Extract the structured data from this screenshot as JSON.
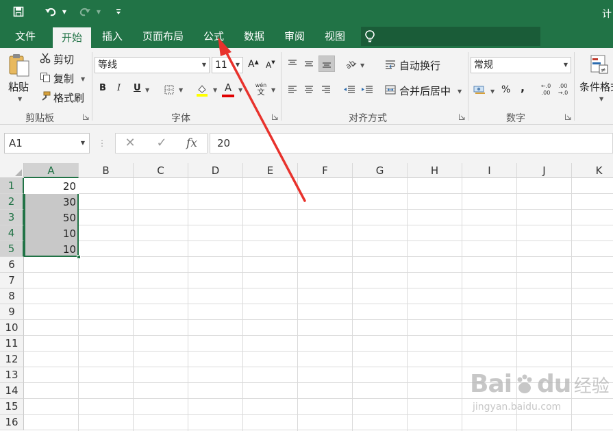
{
  "title_bar": {
    "save_icon": "save-icon",
    "undo_icon": "undo-icon",
    "redo_icon": "redo-icon",
    "customize_icon": "customize-qat-icon",
    "title_text": "计"
  },
  "tabs": [
    {
      "label": "文件",
      "active": false
    },
    {
      "label": "开始",
      "active": true
    },
    {
      "label": "插入",
      "active": false
    },
    {
      "label": "页面布局",
      "active": false
    },
    {
      "label": "公式",
      "active": false
    },
    {
      "label": "数据",
      "active": false
    },
    {
      "label": "审阅",
      "active": false
    },
    {
      "label": "视图",
      "active": false
    }
  ],
  "tell_me_icon": "lightbulb-icon",
  "ribbon": {
    "clipboard": {
      "paste_label": "粘贴",
      "cut_label": "剪切",
      "copy_label": "复制",
      "format_painter_label": "格式刷",
      "group_label": "剪贴板"
    },
    "font": {
      "font_name": "等线",
      "font_size": "11",
      "grow_label": "A",
      "shrink_label": "A",
      "bold_label": "B",
      "italic_label": "I",
      "underline_label": "U",
      "font_color_label": "A",
      "phonetic_top": "wén",
      "phonetic_bottom": "文",
      "group_label": "字体",
      "fill_color": "#ffff00",
      "font_color": "#e00000"
    },
    "alignment": {
      "wrap_text_label": "自动换行",
      "merge_center_label": "合并后居中",
      "group_label": "对齐方式"
    },
    "number": {
      "format": "常规",
      "percent_label": "%",
      "comma_label": ",",
      "inc_decimal_top": "←.0",
      "inc_decimal_bottom": ".00",
      "dec_decimal_top": ".00",
      "dec_decimal_bottom": "→.0",
      "group_label": "数字"
    },
    "styles": {
      "conditional_format_label": "条件格式"
    }
  },
  "formula_bar": {
    "name_box": "A1",
    "cancel_label": "✕",
    "enter_label": "✓",
    "fx_label": "fx",
    "value": "20"
  },
  "sheet": {
    "columns": [
      "A",
      "B",
      "C",
      "D",
      "E",
      "F",
      "G",
      "H",
      "I",
      "J",
      "K"
    ],
    "rows": [
      "1",
      "2",
      "3",
      "4",
      "5",
      "6",
      "7",
      "8",
      "9",
      "10",
      "11",
      "12",
      "13",
      "14",
      "15",
      "16"
    ],
    "a_values": [
      "20",
      "30",
      "50",
      "10",
      "10"
    ]
  },
  "watermark": {
    "brand": "Bai",
    "brand2": "du",
    "cn": "经验",
    "url": "jingyan.baidu.com"
  },
  "colors": {
    "excel_green": "#217346",
    "annotation_arrow": "#e8322c"
  }
}
